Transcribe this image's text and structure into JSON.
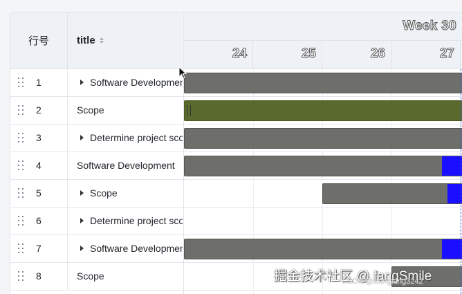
{
  "table": {
    "headers": {
      "row_no": "行号",
      "title": "title"
    },
    "rows": [
      {
        "no": "1",
        "title": "Software Development",
        "expandable": true
      },
      {
        "no": "2",
        "title": "Scope",
        "expandable": false
      },
      {
        "no": "3",
        "title": "Determine project scope",
        "expandable": true
      },
      {
        "no": "4",
        "title": "Software Development",
        "expandable": false
      },
      {
        "no": "5",
        "title": "Scope",
        "expandable": true
      },
      {
        "no": "6",
        "title": "Determine project scope",
        "expandable": true
      },
      {
        "no": "7",
        "title": "Software Development",
        "expandable": true
      },
      {
        "no": "8",
        "title": "Scope",
        "expandable": false
      }
    ]
  },
  "timeline": {
    "week_label": "Week 30",
    "days": [
      "24",
      "25",
      "26",
      "27"
    ]
  },
  "colors": {
    "bar": "#6e6e6a",
    "scope_bar": "#5a6a2e",
    "progress": "#1a0fff",
    "today_line": "#3b5bd6"
  },
  "watermark": {
    "main": "掘金技术社区 @ fangSmile",
    "sub": "CSDN @lifangfang3242"
  }
}
